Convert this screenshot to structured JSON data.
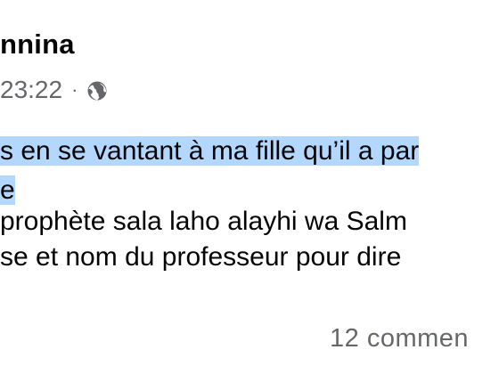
{
  "post": {
    "author_name": "nnina",
    "time": "23:22",
    "separator": "·",
    "audience_icon": "globe-icon",
    "text_lines": [
      "s en se vantant à ma fille qu’il a par",
      "e",
      "prophète sala laho alayhi wa Salm",
      "se et nom du professeur pour dire"
    ],
    "comments_label": "12 commen"
  },
  "colors": {
    "highlight": "#b3d7ff",
    "secondary_text": "#65676b",
    "primary_text": "#050505"
  }
}
